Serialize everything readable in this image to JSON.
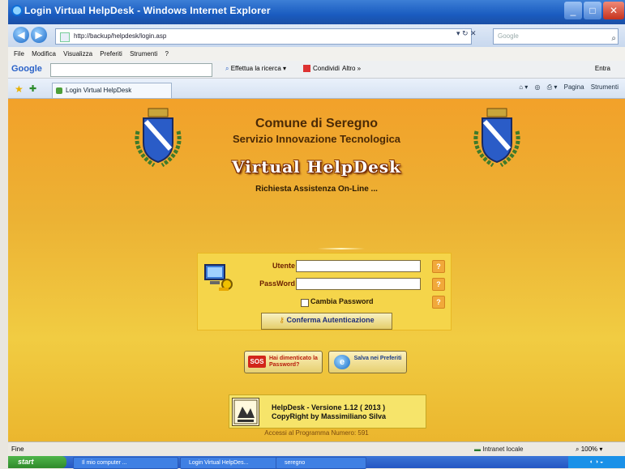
{
  "window": {
    "title": "Login Virtual HelpDesk - Windows Internet Explorer",
    "controls": {
      "minimize": "_",
      "maximize": "□",
      "close": "✕"
    }
  },
  "nav": {
    "back_icon": "back-arrow-icon",
    "forward_icon": "forward-arrow-icon",
    "address": "http://backup/helpdesk/login.asp",
    "address_tools": "▾ ↻ ✕",
    "search_placeholder": "Google",
    "search_go": "⌕"
  },
  "menu": {
    "items": [
      "File",
      "Modifica",
      "Visualizza",
      "Preferiti",
      "Strumenti",
      "?"
    ]
  },
  "google_toolbar": {
    "logo": "Google",
    "search_button": "Effettua la ricerca",
    "share_button": "Condividi",
    "more": "Altro »",
    "signin": "Entra"
  },
  "favorites_bar": {
    "tab_label": "Login Virtual HelpDesk",
    "commands": [
      "Pagina",
      "Strumenti"
    ]
  },
  "page": {
    "heading": "Comune di Seregno",
    "subheading": "Servizio Innovazione Tecnologica",
    "app_title": "Virtual HelpDesk",
    "tagline": "Richiesta Assistenza On-Line ...",
    "login": {
      "user_label": "Utente",
      "user_value": "",
      "password_label": "PassWord",
      "password_value": "",
      "help_glyph": "?",
      "change_password_label": "Cambia Password",
      "change_password_checked": false,
      "confirm_button": "Conferma Autenticazione"
    },
    "sos_button": {
      "badge": "SOS",
      "label": "Hai dimenticato la Password?"
    },
    "favorites_button": {
      "label": "Salva nei Preferiti"
    },
    "version_line1": "HelpDesk - Versione 1.12 ( 2013 )",
    "version_line2": "CopyRight by Massimiliano Silva",
    "access_counter": "Accessi al Programma Numero: 591"
  },
  "statusbar": {
    "text": "Fine",
    "zone": "Intranet locale",
    "zoom": "100%"
  },
  "taskbar": {
    "start": "start",
    "tasks": [
      "Il mio computer ...",
      "Login Virtual HelpDes...",
      "seregno"
    ]
  },
  "colors": {
    "page_gradient_top": "#f2a12a",
    "page_gradient_bottom": "#ebb62e",
    "panel": "#f5d54a",
    "heading": "#4b2a06"
  }
}
